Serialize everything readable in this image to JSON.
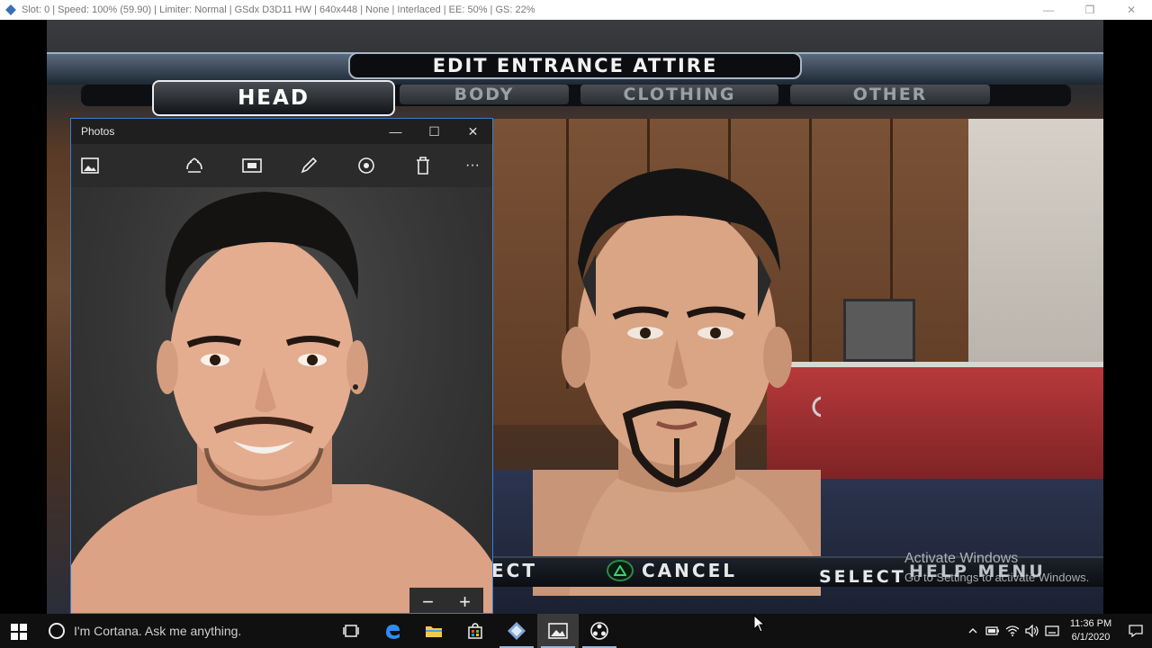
{
  "emulator": {
    "title": "Slot: 0 | Speed: 100% (59.90) | Limiter: Normal | GSdx D3D11 HW | 640x448 | None | Interlaced | EE: 50% | GS: 22%",
    "minimize": "—",
    "maximize": "❐",
    "close": "✕"
  },
  "game": {
    "header_title": "EDIT ENTRANCE ATTIRE",
    "tabs": [
      {
        "label": "HEAD",
        "active": true
      },
      {
        "label": "BODY",
        "active": false
      },
      {
        "label": "CLOTHING",
        "active": false
      },
      {
        "label": "OTHER",
        "active": false
      }
    ],
    "footer": {
      "select_fragment": "ECT",
      "cancel": "CANCEL",
      "select_label": "SELECT",
      "help_menu": "HELP MENU"
    }
  },
  "photos": {
    "title": "Photos",
    "minimize": "—",
    "maximize": "☐",
    "close": "✕",
    "toolbar_icons": [
      "image-icon",
      "share-icon",
      "slideshow-icon",
      "pen-icon",
      "enhance-icon",
      "delete-icon",
      "more-icon"
    ],
    "more_glyph": "···",
    "zoom_out": "−",
    "zoom_in": "+"
  },
  "watermark": {
    "line1": "Activate Windows",
    "line2": "Go to Settings to activate Windows."
  },
  "taskbar": {
    "search_placeholder": "I'm Cortana. Ask me anything.",
    "time": "11:36 PM",
    "date": "6/1/2020"
  },
  "colors": {
    "accent_blue": "#3b7bd2",
    "taskbar": "#101010",
    "playstation_green": "#2a8a4a"
  }
}
